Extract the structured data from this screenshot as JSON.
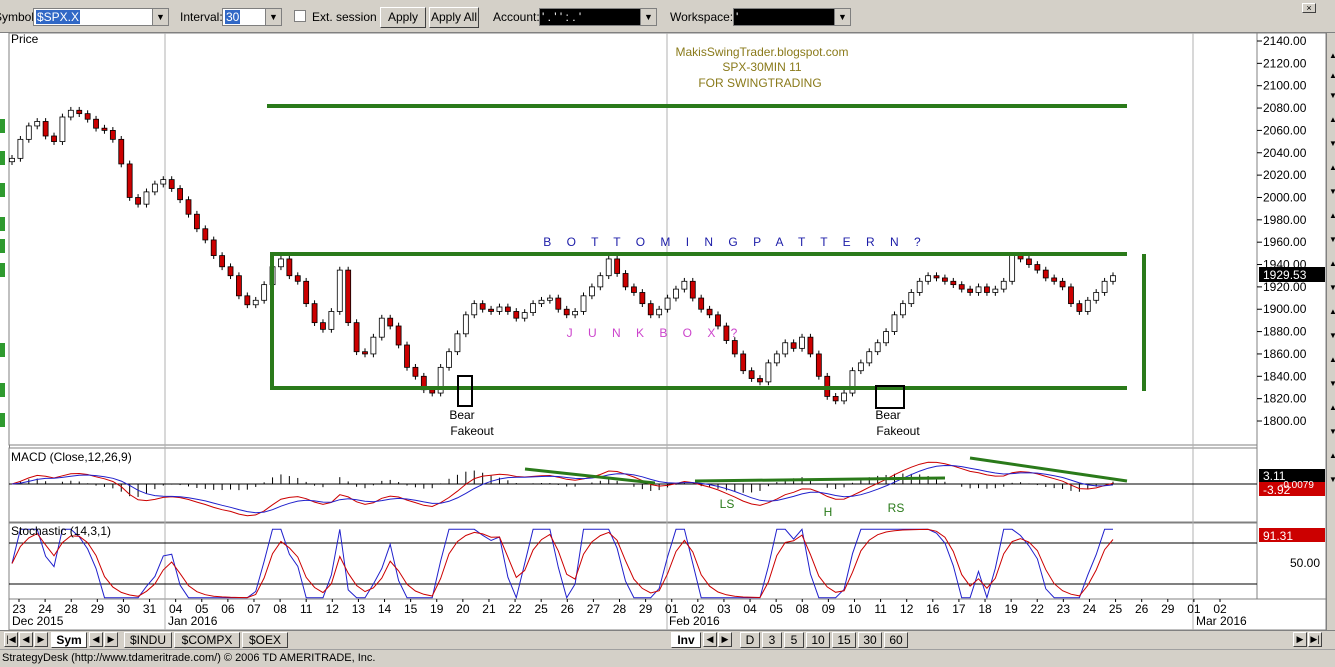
{
  "toolbar": {
    "symbol_label": "Symbol:",
    "symbol_value": "$SPX.X",
    "interval_label": "Interval:",
    "interval_value": "30",
    "ext_session_label": "Ext. session",
    "ext_session_checked": false,
    "apply_label": "Apply",
    "apply_all_label": "Apply All",
    "account_label": "Account:",
    "account_value": "' . ' ' : . '",
    "workspace_label": "Workspace:",
    "workspace_value": "'"
  },
  "chart": {
    "price_title": "Price",
    "watermark": [
      "MakisSwingTrader.blogspot.com",
      "SPX-30MIN  11",
      "FOR SWINGTRADING"
    ],
    "pattern_label": "B O T T O M I N G     P A T T E R N ?",
    "junk_label": "J   U   N   K     B   O   X ?",
    "bear_label_1": "Bear",
    "fakeout_label_1": "Fakeout",
    "bear_label_2": "Bear",
    "fakeout_label_2": "Fakeout",
    "current_price": "1929.53",
    "price_axis_ticks": [
      "2140.00",
      "2120.00",
      "2100.00",
      "2080.00",
      "2060.00",
      "2040.00",
      "2020.00",
      "2000.00",
      "1980.00",
      "1960.00",
      "1940.00",
      "1920.00",
      "1900.00",
      "1880.00",
      "1860.00",
      "1840.00",
      "1820.00",
      "1800.00"
    ],
    "macd_title": "MACD (Close,12,26,9)",
    "macd_value_1": "3.11",
    "macd_value_2": "-0.0079",
    "macd_value_3": "-3.92",
    "ls_label": "LS",
    "h_label": "H",
    "rs_label": "RS",
    "stoch_title": "Stochastic (14,3,1)",
    "stoch_value": "91.31",
    "stoch_tick": "50.00",
    "date_ticks": [
      "23",
      "24",
      "28",
      "29",
      "30",
      "31",
      "04",
      "05",
      "06",
      "07",
      "08",
      "11",
      "12",
      "13",
      "14",
      "15",
      "19",
      "20",
      "21",
      "22",
      "25",
      "26",
      "27",
      "28",
      "29",
      "01",
      "02",
      "03",
      "04",
      "05",
      "08",
      "09",
      "10",
      "11",
      "12",
      "16",
      "17",
      "18",
      "19",
      "22",
      "23",
      "24",
      "25",
      "26",
      "29",
      "01",
      "02"
    ],
    "month_labels": [
      "Dec 2015",
      "Jan 2016",
      "Feb 2016",
      "Mar 2016"
    ],
    "colors": {
      "green_line": "#2a7a1a",
      "bull_candle": "#ffffff",
      "bear_candle": "#cc0000",
      "label_blue": "#1c1ca8",
      "label_magenta": "#cc44cc",
      "watermark": "#8a7a1a",
      "macd_line": "#cc0000",
      "signal_line": "#2020cc",
      "stoch_k": "#cc0000",
      "stoch_d": "#2020cc"
    }
  },
  "chart_data": {
    "type": "candlestick",
    "title": "SPX-30MIN  11",
    "symbol": "$SPX.X",
    "interval": "30",
    "ylim": [
      1790,
      2145
    ],
    "channel": {
      "top": 1949,
      "bottom": 1829
    },
    "upper_line": 2080,
    "close_series": [
      2035,
      2052,
      2064,
      2068,
      2055,
      2050,
      2072,
      2078,
      2075,
      2070,
      2062,
      2060,
      2052,
      2030,
      2000,
      1994,
      2005,
      2012,
      2016,
      2008,
      1998,
      1985,
      1972,
      1962,
      1948,
      1938,
      1930,
      1912,
      1904,
      1908,
      1922,
      1938,
      1945,
      1930,
      1925,
      1905,
      1888,
      1882,
      1898,
      1935,
      1888,
      1862,
      1860,
      1875,
      1892,
      1885,
      1868,
      1848,
      1840,
      1828,
      1825,
      1848,
      1862,
      1878,
      1895,
      1905,
      1900,
      1898,
      1902,
      1898,
      1892,
      1897,
      1905,
      1908,
      1910,
      1900,
      1895,
      1898,
      1912,
      1920,
      1930,
      1945,
      1932,
      1920,
      1915,
      1905,
      1895,
      1900,
      1910,
      1918,
      1925,
      1910,
      1900,
      1895,
      1885,
      1872,
      1860,
      1845,
      1838,
      1835,
      1852,
      1860,
      1870,
      1865,
      1875,
      1860,
      1840,
      1822,
      1818,
      1825,
      1845,
      1852,
      1862,
      1870,
      1880,
      1895,
      1905,
      1915,
      1925,
      1930,
      1928,
      1925,
      1922,
      1918,
      1915,
      1920,
      1915,
      1918,
      1925,
      1948,
      1945,
      1940,
      1935,
      1928,
      1925,
      1920,
      1905,
      1898,
      1908,
      1915,
      1925,
      1930
    ]
  }
}
